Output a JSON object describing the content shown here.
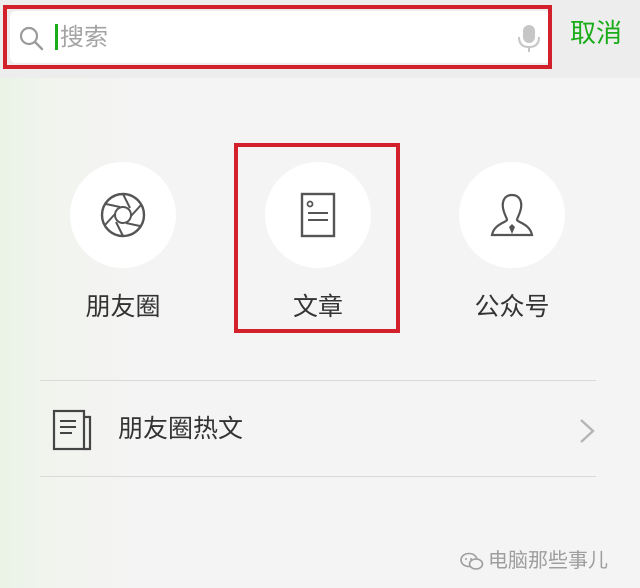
{
  "search": {
    "placeholder": "搜索",
    "cancel_label": "取消"
  },
  "categories": [
    {
      "label": "朋友圈",
      "icon": "aperture-icon"
    },
    {
      "label": "文章",
      "icon": "document-icon"
    },
    {
      "label": "公众号",
      "icon": "person-icon"
    }
  ],
  "hot_articles": {
    "label": "朋友圈热文",
    "icon": "newspaper-icon"
  },
  "watermark": {
    "text": "电脑那些事儿"
  },
  "colors": {
    "accent": "#1aad19",
    "highlight": "#d2212a"
  }
}
